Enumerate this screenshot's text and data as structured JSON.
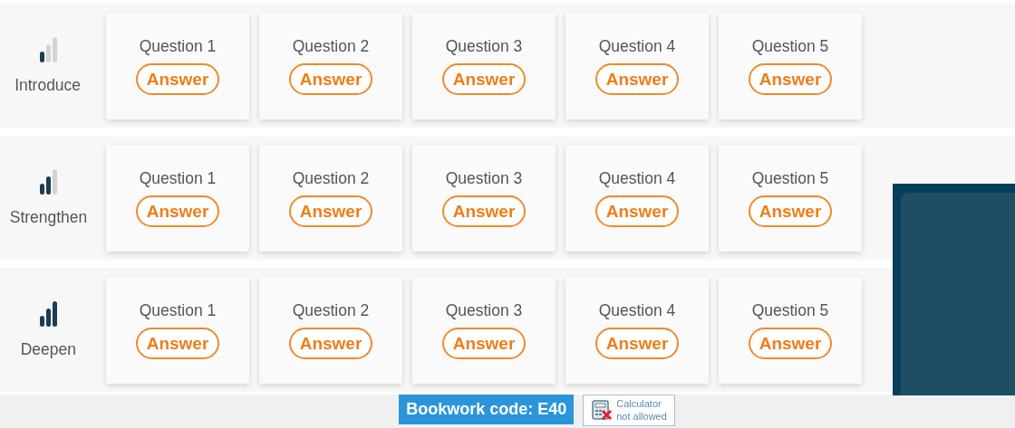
{
  "levels": [
    {
      "label": "Introduce",
      "questions": [
        {
          "title": "Question 1",
          "action": "Answer"
        },
        {
          "title": "Question 2",
          "action": "Answer"
        },
        {
          "title": "Question 3",
          "action": "Answer"
        },
        {
          "title": "Question 4",
          "action": "Answer"
        },
        {
          "title": "Question 5",
          "action": "Answer"
        }
      ]
    },
    {
      "label": "Strengthen",
      "questions": [
        {
          "title": "Question 1",
          "action": "Answer"
        },
        {
          "title": "Question 2",
          "action": "Answer"
        },
        {
          "title": "Question 3",
          "action": "Answer"
        },
        {
          "title": "Question 4",
          "action": "Answer"
        },
        {
          "title": "Question 5",
          "action": "Answer"
        }
      ]
    },
    {
      "label": "Deepen",
      "questions": [
        {
          "title": "Question 1",
          "action": "Answer"
        },
        {
          "title": "Question 2",
          "action": "Answer"
        },
        {
          "title": "Question 3",
          "action": "Answer"
        },
        {
          "title": "Question 4",
          "action": "Answer"
        },
        {
          "title": "Question 5",
          "action": "Answer"
        }
      ]
    }
  ],
  "footer": {
    "bookwork_code": "Bookwork code: E40",
    "calculator": {
      "allowed": false,
      "line_1": "Calculator",
      "line_2": "not allowed"
    }
  }
}
